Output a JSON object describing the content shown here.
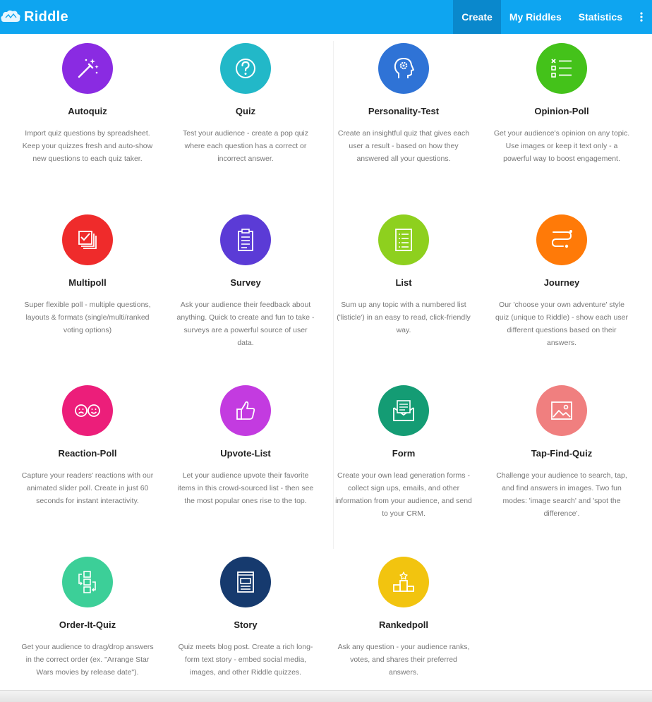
{
  "app": {
    "name": "Riddle"
  },
  "nav": {
    "create": "Create",
    "my_riddles": "My Riddles",
    "statistics": "Statistics",
    "more_icon": "vertical-dots"
  },
  "colors": {
    "topbar": "#0ea5f0",
    "autoquiz": "#8a2be2",
    "quiz": "#22b8c8",
    "personality": "#2f73d6",
    "opinion": "#44c21a",
    "multipoll": "#ef2b2b",
    "survey": "#5b3bd6",
    "list": "#8ed01e",
    "journey": "#ff7a08",
    "reaction": "#ec1e7a",
    "upvote": "#c33be0",
    "form": "#149c74",
    "tapfind": "#f07f7f",
    "order": "#3ccf98",
    "story": "#163a6e",
    "ranked": "#f2c40f"
  },
  "cards": [
    {
      "title": "Autoquiz",
      "icon": "magic-wand-icon",
      "desc": "Import quiz questions by spreadsheet. Keep your quizzes fresh and auto-show new questions to each quiz taker."
    },
    {
      "title": "Quiz",
      "icon": "question-icon",
      "desc": "Test your audience - create a pop quiz where each question has a correct or incorrect answer."
    },
    {
      "title": "Personality-Test",
      "icon": "head-gear-icon",
      "desc": "Create an insightful quiz that gives each user a result - based on how they answered all your questions."
    },
    {
      "title": "Opinion-Poll",
      "icon": "checklist-icon",
      "desc": "Get your audience's opinion on any topic. Use images or keep it text only - a powerful way to boost engagement."
    },
    {
      "title": "Multipoll",
      "icon": "stacked-checkbox-icon",
      "desc": "Super flexible poll - multiple questions, layouts & formats (single/multi/ranked voting options)"
    },
    {
      "title": "Survey",
      "icon": "clipboard-icon",
      "desc": "Ask your audience their feedback about anything. Quick to create and fun to take - surveys are a powerful source of user data."
    },
    {
      "title": "List",
      "icon": "list-document-icon",
      "desc": "Sum up any topic with a numbered list ('listicle') in an easy to read, click-friendly way."
    },
    {
      "title": "Journey",
      "icon": "path-icon",
      "desc": "Our 'choose your own adventure' style quiz (unique to Riddle) - show each user different questions based on their answers."
    },
    {
      "title": "Reaction-Poll",
      "icon": "faces-icon",
      "desc": "Capture your readers' reactions with our animated slider poll. Create in just 60 seconds for instant interactivity."
    },
    {
      "title": "Upvote-List",
      "icon": "thumbs-up-icon",
      "desc": "Let your audience upvote their favorite items in this crowd-sourced list - then see the most popular ones rise to the top."
    },
    {
      "title": "Form",
      "icon": "envelope-icon",
      "desc": "Create your own lead generation forms - collect sign ups, emails, and other information from your audience, and send to your CRM."
    },
    {
      "title": "Tap-Find-Quiz",
      "icon": "image-icon",
      "desc": "Challenge your audience to search, tap, and find answers in images. Two fun modes: 'image search' and 'spot the difference'."
    },
    {
      "title": "Order-It-Quiz",
      "icon": "reorder-icon",
      "desc": "Get your audience to drag/drop answers in the correct order (ex. \"Arrange Star Wars movies by release date\")."
    },
    {
      "title": "Story",
      "icon": "book-icon",
      "desc": "Quiz meets blog post. Create a rich long-form text story - embed social media, images, and other Riddle quizzes."
    },
    {
      "title": "Rankedpoll",
      "icon": "podium-icon",
      "desc": "Ask any question - your audience ranks, votes, and shares their preferred answers."
    }
  ]
}
